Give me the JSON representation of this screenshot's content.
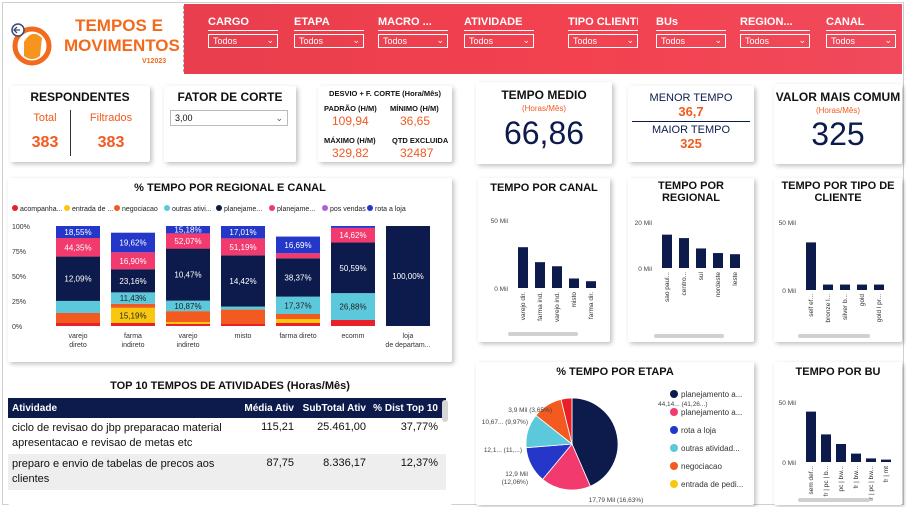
{
  "header": {
    "title_line1": "TEMPOS E",
    "title_line2": "MOVIMENTOS",
    "version": "V12023",
    "logo_text": "alpha 2.0"
  },
  "filters": [
    {
      "label": "CARGO",
      "value": "Todos"
    },
    {
      "label": "ETAPA",
      "value": "Todos"
    },
    {
      "label": "MACRO ...",
      "value": "Todos"
    },
    {
      "label": "ATIVIDADE",
      "value": "Todos"
    },
    {
      "label": "TIPO CLIENTE",
      "value": "Todos"
    },
    {
      "label": "BUs",
      "value": "Todos"
    },
    {
      "label": "REGION...",
      "value": "Todos"
    },
    {
      "label": "CANAL",
      "value": "Todos"
    }
  ],
  "respondentes": {
    "title": "RESPONDENTES",
    "total_label": "Total",
    "total_value": "383",
    "filtrados_label": "Filtrados",
    "filtrados_value": "383"
  },
  "fator": {
    "title": "FATOR DE CORTE",
    "value": "3,00"
  },
  "desvio": {
    "title": "DESVIO + F. CORTE (Hora/Mês)",
    "padrao_label": "PADRÃO (H/M)",
    "padrao_value": "109,94",
    "minimo_label": "MÍNIMO (H/M)",
    "minimo_value": "36,65",
    "maximo_label": "MÁXIMO (H/M)",
    "maximo_value": "329,82",
    "qtd_label": "QTD EXCLUIDA",
    "qtd_value": "32487"
  },
  "tempo_medio": {
    "title": "TEMPO MEDIO",
    "subtitle": "(Horas/Mês)",
    "value": "66,86"
  },
  "menor_maior": {
    "menor_label": "MENOR TEMPO",
    "menor_value": "36,7",
    "maior_label": "MAIOR TEMPO",
    "maior_value": "325"
  },
  "valor_comum": {
    "title": "VALOR MAIS COMUM",
    "subtitle": "(Horas/Mês)",
    "value": "325"
  },
  "colors": {
    "navy": "#0d1b4c",
    "orange": "#f25a1f",
    "red": "#e8202a",
    "yellow": "#f9c80e",
    "cyan": "#5bc8db",
    "pink": "#f23a6e",
    "purple": "#b05fd8",
    "blue": "#2437c8",
    "header_red": "#f3414f"
  },
  "regional_canal": {
    "title": "% TEMPO POR REGIONAL E CANAL",
    "legend": [
      {
        "name": "acompanha...",
        "color": "#e8202a"
      },
      {
        "name": "entrada de ...",
        "color": "#f9c80e"
      },
      {
        "name": "negociacao",
        "color": "#f25a1f"
      },
      {
        "name": "outras ativi...",
        "color": "#5bc8db"
      },
      {
        "name": "planejame...",
        "color": "#0d1b4c"
      },
      {
        "name": "planejame...",
        "color": "#f23a6e"
      },
      {
        "name": "pos vendas",
        "color": "#b05fd8"
      },
      {
        "name": "rota a loja",
        "color": "#2437c8"
      }
    ],
    "yticks": [
      "100%",
      "75%",
      "50%",
      "25%",
      "0%"
    ]
  },
  "chart_data": [
    {
      "type": "bar",
      "title": "% TEMPO POR REGIONAL E CANAL",
      "stacked": true,
      "categories": [
        "varejo direto",
        "farma indireto",
        "varejo indireto",
        "misto",
        "farma direto",
        "ecomm",
        "loja de departam..."
      ],
      "series": [
        {
          "name": "acompanha...",
          "values": [
            3,
            3,
            2,
            2,
            3,
            6,
            0
          ]
        },
        {
          "name": "entrada de ...",
          "values": [
            0,
            15.19,
            2,
            0,
            4,
            0,
            0
          ]
        },
        {
          "name": "negociacao",
          "values": [
            10,
            4,
            10.87,
            14.42,
            5,
            0,
            0
          ]
        },
        {
          "name": "outras ativi...",
          "values": [
            12.09,
            11.43,
            10.47,
            3,
            17.37,
            26.88,
            0
          ]
        },
        {
          "name": "planejame...",
          "values": [
            44.35,
            23.16,
            52.07,
            51.19,
            38.37,
            50.59,
            100
          ]
        },
        {
          "name": "planejame...",
          "values": [
            18.55,
            16.9,
            15.18,
            17.01,
            5,
            14.62,
            0
          ]
        },
        {
          "name": "pos vendas",
          "values": [
            0,
            0,
            0,
            0,
            0,
            0,
            0
          ]
        },
        {
          "name": "rota a loja",
          "values": [
            12.01,
            19.62,
            7.41,
            12.38,
            16.69,
            1.91,
            0
          ]
        }
      ],
      "labels": {
        "varejo direto": [
          "18,55%",
          "44,35%",
          "12,09%"
        ],
        "farma indireto": [
          "19,62%",
          "16,90%",
          "23,16%",
          "11,43%",
          "15,19%"
        ],
        "varejo indireto": [
          "15,18%",
          "52,07%",
          "10,47%",
          "10,87%"
        ],
        "misto": [
          "17,01%",
          "51,19%",
          "14,42%"
        ],
        "farma direto": [
          "16,69%",
          "38,37%",
          "17,37%"
        ],
        "ecomm": [
          "14,62%",
          "50,59%",
          "26,88%"
        ],
        "loja de departam...": [
          "100,00%"
        ]
      },
      "ylim": [
        0,
        100
      ]
    },
    {
      "type": "bar",
      "title": "TEMPO POR CANAL",
      "categories": [
        "varejo dir.",
        "farma ind.",
        "varejo ind.",
        "misto",
        "farma dir."
      ],
      "values": [
        30,
        19,
        16,
        7,
        5
      ],
      "ylim": [
        0,
        50
      ],
      "ytick_labels": [
        "50 Mil",
        "0 Mil"
      ]
    },
    {
      "type": "bar",
      "title": "TEMPO POR REGIONAL",
      "categories": [
        "sao paul...",
        "centro...",
        "sul",
        "nordeste",
        "leste"
      ],
      "values": [
        29,
        26,
        17,
        13,
        12
      ],
      "ylim": [
        0,
        40
      ],
      "ytick_labels": [
        "20 Mil",
        "0 Mil"
      ]
    },
    {
      "type": "bar",
      "title": "TEMPO POR TIPO DE CLIENTE",
      "categories": [
        "self ef...",
        "bronze l...",
        "silver b...",
        "gold",
        "gold l pr..."
      ],
      "values": [
        35,
        4,
        4,
        4,
        4
      ],
      "ylim": [
        0,
        50
      ],
      "ytick_labels": [
        "50 Mil",
        "0 Mil"
      ]
    },
    {
      "type": "pie",
      "title": "% TEMPO POR ETAPA",
      "slices": [
        {
          "name": "planejamento a...",
          "value": 44.14,
          "label": "44,14... (41,26...)",
          "color": "#0d1b4c"
        },
        {
          "name": "planejamento a...",
          "value": 17.79,
          "label": "17,79 Mil (16,63%)",
          "color": "#f23a6e"
        },
        {
          "name": "rota a loja",
          "value": 12.9,
          "label": "12,9 Mil (12,06%)",
          "color": "#5bc8db"
        },
        {
          "name": "outras atividad...",
          "value": 12.1,
          "label": "12,1... (11,...)",
          "color": "#5bc8db"
        },
        {
          "name": "negociacao",
          "value": 10.67,
          "label": "10,67... (9,97%)",
          "color": "#f25a1f"
        },
        {
          "name": "entrada de pedi...",
          "value": 3.9,
          "label": "3,9 Mil (3,65%)",
          "color": "#e8202a"
        }
      ],
      "legend": [
        "planejamento a...",
        "planejamento a...",
        "rota a loja",
        "outras atividad...",
        "negociacao",
        "entrada de pedi..."
      ]
    },
    {
      "type": "bar",
      "title": "TEMPO POR BU",
      "categories": [
        "sem def...",
        "fr | pc | b...",
        "pc | bw...",
        "fr | bw...",
        "fr | pc | bw...",
        "fr | mt"
      ],
      "values": [
        42,
        23,
        15,
        7,
        3,
        2
      ],
      "ylim": [
        0,
        50
      ],
      "ytick_labels": [
        "50 Mil",
        "0 Mil"
      ]
    }
  ],
  "top10": {
    "title": "TOP 10 TEMPOS DE ATIVIDADES (Horas/Mês)",
    "columns": [
      "Atividade",
      "Média Ativ",
      "SubTotal Ativ",
      "% Dist Top 10"
    ],
    "rows": [
      [
        "ciclo de revisao do jbp preparacao material apresentacao e revisao de metas etc",
        "115,21",
        "25.461,00",
        "37,77%"
      ],
      [
        "preparo e envio de tabelas de precos aos clientes",
        "87,75",
        "8.336,17",
        "12,37%"
      ]
    ]
  }
}
